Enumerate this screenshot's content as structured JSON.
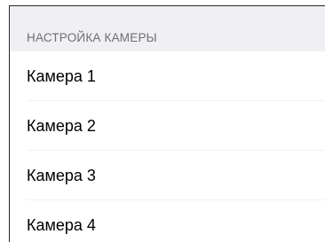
{
  "section": {
    "title": "НАСТРОЙКА КАМЕРЫ"
  },
  "cameras": [
    {
      "label": "Камера 1"
    },
    {
      "label": "Камера 2"
    },
    {
      "label": "Камера 3"
    },
    {
      "label": "Камера 4"
    }
  ]
}
